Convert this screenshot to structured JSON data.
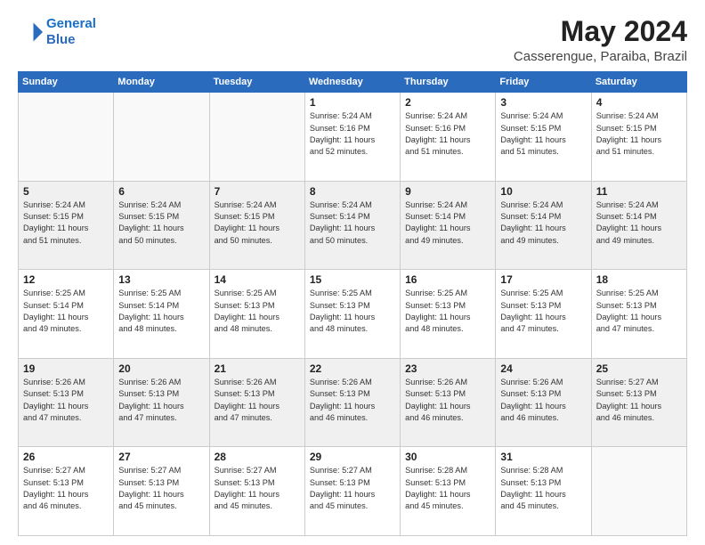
{
  "logo": {
    "line1": "General",
    "line2": "Blue"
  },
  "title": "May 2024",
  "subtitle": "Casserengue, Paraiba, Brazil",
  "days_of_week": [
    "Sunday",
    "Monday",
    "Tuesday",
    "Wednesday",
    "Thursday",
    "Friday",
    "Saturday"
  ],
  "weeks": [
    [
      {
        "day": "",
        "info": ""
      },
      {
        "day": "",
        "info": ""
      },
      {
        "day": "",
        "info": ""
      },
      {
        "day": "1",
        "info": "Sunrise: 5:24 AM\nSunset: 5:16 PM\nDaylight: 11 hours\nand 52 minutes."
      },
      {
        "day": "2",
        "info": "Sunrise: 5:24 AM\nSunset: 5:16 PM\nDaylight: 11 hours\nand 51 minutes."
      },
      {
        "day": "3",
        "info": "Sunrise: 5:24 AM\nSunset: 5:15 PM\nDaylight: 11 hours\nand 51 minutes."
      },
      {
        "day": "4",
        "info": "Sunrise: 5:24 AM\nSunset: 5:15 PM\nDaylight: 11 hours\nand 51 minutes."
      }
    ],
    [
      {
        "day": "5",
        "info": "Sunrise: 5:24 AM\nSunset: 5:15 PM\nDaylight: 11 hours\nand 51 minutes."
      },
      {
        "day": "6",
        "info": "Sunrise: 5:24 AM\nSunset: 5:15 PM\nDaylight: 11 hours\nand 50 minutes."
      },
      {
        "day": "7",
        "info": "Sunrise: 5:24 AM\nSunset: 5:15 PM\nDaylight: 11 hours\nand 50 minutes."
      },
      {
        "day": "8",
        "info": "Sunrise: 5:24 AM\nSunset: 5:14 PM\nDaylight: 11 hours\nand 50 minutes."
      },
      {
        "day": "9",
        "info": "Sunrise: 5:24 AM\nSunset: 5:14 PM\nDaylight: 11 hours\nand 49 minutes."
      },
      {
        "day": "10",
        "info": "Sunrise: 5:24 AM\nSunset: 5:14 PM\nDaylight: 11 hours\nand 49 minutes."
      },
      {
        "day": "11",
        "info": "Sunrise: 5:24 AM\nSunset: 5:14 PM\nDaylight: 11 hours\nand 49 minutes."
      }
    ],
    [
      {
        "day": "12",
        "info": "Sunrise: 5:25 AM\nSunset: 5:14 PM\nDaylight: 11 hours\nand 49 minutes."
      },
      {
        "day": "13",
        "info": "Sunrise: 5:25 AM\nSunset: 5:14 PM\nDaylight: 11 hours\nand 48 minutes."
      },
      {
        "day": "14",
        "info": "Sunrise: 5:25 AM\nSunset: 5:13 PM\nDaylight: 11 hours\nand 48 minutes."
      },
      {
        "day": "15",
        "info": "Sunrise: 5:25 AM\nSunset: 5:13 PM\nDaylight: 11 hours\nand 48 minutes."
      },
      {
        "day": "16",
        "info": "Sunrise: 5:25 AM\nSunset: 5:13 PM\nDaylight: 11 hours\nand 48 minutes."
      },
      {
        "day": "17",
        "info": "Sunrise: 5:25 AM\nSunset: 5:13 PM\nDaylight: 11 hours\nand 47 minutes."
      },
      {
        "day": "18",
        "info": "Sunrise: 5:25 AM\nSunset: 5:13 PM\nDaylight: 11 hours\nand 47 minutes."
      }
    ],
    [
      {
        "day": "19",
        "info": "Sunrise: 5:26 AM\nSunset: 5:13 PM\nDaylight: 11 hours\nand 47 minutes."
      },
      {
        "day": "20",
        "info": "Sunrise: 5:26 AM\nSunset: 5:13 PM\nDaylight: 11 hours\nand 47 minutes."
      },
      {
        "day": "21",
        "info": "Sunrise: 5:26 AM\nSunset: 5:13 PM\nDaylight: 11 hours\nand 47 minutes."
      },
      {
        "day": "22",
        "info": "Sunrise: 5:26 AM\nSunset: 5:13 PM\nDaylight: 11 hours\nand 46 minutes."
      },
      {
        "day": "23",
        "info": "Sunrise: 5:26 AM\nSunset: 5:13 PM\nDaylight: 11 hours\nand 46 minutes."
      },
      {
        "day": "24",
        "info": "Sunrise: 5:26 AM\nSunset: 5:13 PM\nDaylight: 11 hours\nand 46 minutes."
      },
      {
        "day": "25",
        "info": "Sunrise: 5:27 AM\nSunset: 5:13 PM\nDaylight: 11 hours\nand 46 minutes."
      }
    ],
    [
      {
        "day": "26",
        "info": "Sunrise: 5:27 AM\nSunset: 5:13 PM\nDaylight: 11 hours\nand 46 minutes."
      },
      {
        "day": "27",
        "info": "Sunrise: 5:27 AM\nSunset: 5:13 PM\nDaylight: 11 hours\nand 45 minutes."
      },
      {
        "day": "28",
        "info": "Sunrise: 5:27 AM\nSunset: 5:13 PM\nDaylight: 11 hours\nand 45 minutes."
      },
      {
        "day": "29",
        "info": "Sunrise: 5:27 AM\nSunset: 5:13 PM\nDaylight: 11 hours\nand 45 minutes."
      },
      {
        "day": "30",
        "info": "Sunrise: 5:28 AM\nSunset: 5:13 PM\nDaylight: 11 hours\nand 45 minutes."
      },
      {
        "day": "31",
        "info": "Sunrise: 5:28 AM\nSunset: 5:13 PM\nDaylight: 11 hours\nand 45 minutes."
      },
      {
        "day": "",
        "info": ""
      }
    ]
  ]
}
